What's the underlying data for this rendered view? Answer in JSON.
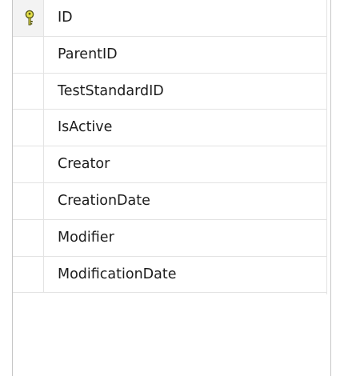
{
  "table": {
    "columns": [
      {
        "name": "ID",
        "primary_key": true,
        "icon": "primary-key-icon"
      },
      {
        "name": "ParentID",
        "primary_key": false
      },
      {
        "name": "TestStandardID",
        "primary_key": false
      },
      {
        "name": "IsActive",
        "primary_key": false
      },
      {
        "name": "Creator",
        "primary_key": false
      },
      {
        "name": "CreationDate",
        "primary_key": false
      },
      {
        "name": "Modifier",
        "primary_key": false
      },
      {
        "name": "ModificationDate",
        "primary_key": false
      }
    ]
  },
  "colors": {
    "key_fill": "#e7e24a",
    "key_outline": "#5a5a1a"
  }
}
